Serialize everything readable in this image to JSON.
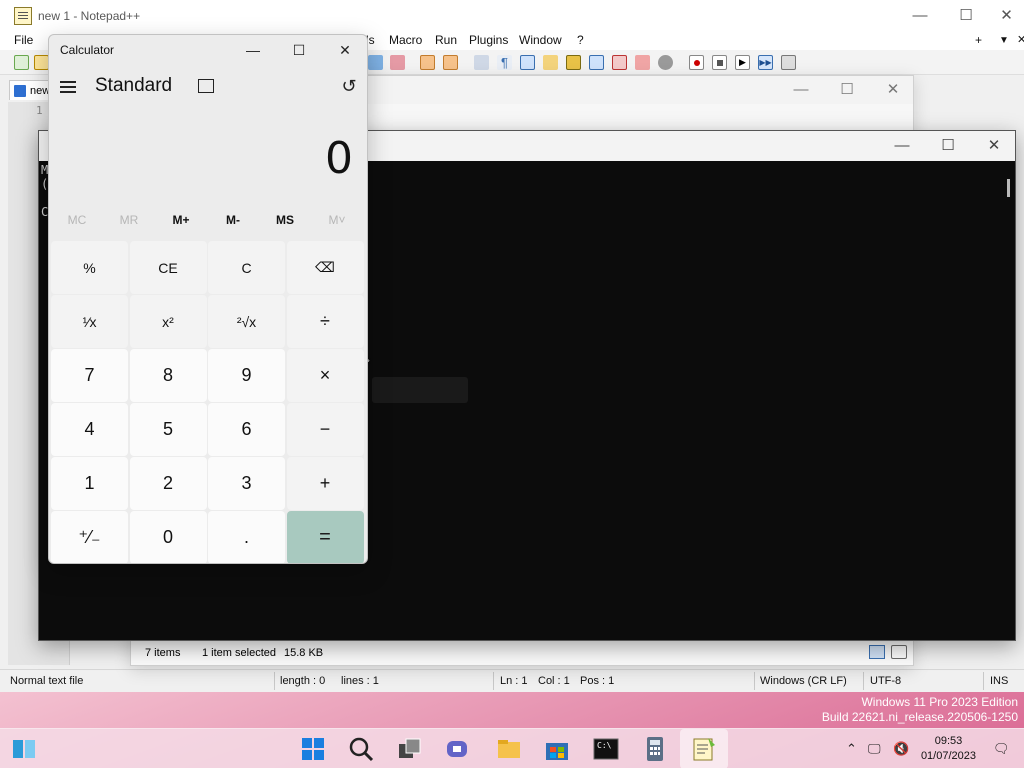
{
  "notepad": {
    "title": "new 1 - Notepad++",
    "menu": [
      "File",
      "Macro",
      "Run",
      "Plugins",
      "Window",
      "?"
    ],
    "menu_fragment": "ls",
    "menu_right": [
      "+",
      "▼",
      "✕"
    ],
    "tab_label": "new",
    "line_number": "1",
    "status": {
      "file_type": "Normal text file",
      "length": "length : 0",
      "lines": "lines : 1",
      "ln": "Ln : 1",
      "col": "Col : 1",
      "pos": "Pos : 1",
      "eol": "Windows (CR LF)",
      "encoding": "UTF-8",
      "mode": "INS"
    }
  },
  "explorer": {
    "status_items": "7 items",
    "status_selected": "1 item selected",
    "status_size": "15.8 KB"
  },
  "terminal": {
    "lines": [
      "M                                    ]",
      "(                                      ved.",
      "",
      "C"
    ]
  },
  "calculator": {
    "title": "Calculator",
    "mode": "Standard",
    "display": "0",
    "memory": [
      "MC",
      "MR",
      "M+",
      "M-",
      "MS",
      "M˅"
    ],
    "memory_enabled": [
      false,
      false,
      true,
      true,
      true,
      false
    ],
    "keys": [
      {
        "label": "%",
        "type": "fn",
        "name": "percent-button"
      },
      {
        "label": "CE",
        "type": "fn",
        "name": "clear-entry-button"
      },
      {
        "label": "C",
        "type": "fn",
        "name": "clear-button"
      },
      {
        "label": "⌫",
        "type": "fn",
        "name": "backspace-button"
      },
      {
        "label": "¹⁄x",
        "type": "fn",
        "name": "reciprocal-button"
      },
      {
        "label": "x²",
        "type": "fn",
        "name": "square-button"
      },
      {
        "label": "²√x",
        "type": "fn",
        "name": "square-root-button"
      },
      {
        "label": "÷",
        "type": "op",
        "name": "divide-button"
      },
      {
        "label": "7",
        "type": "num",
        "name": "digit-7-button"
      },
      {
        "label": "8",
        "type": "num",
        "name": "digit-8-button"
      },
      {
        "label": "9",
        "type": "num",
        "name": "digit-9-button"
      },
      {
        "label": "×",
        "type": "op",
        "name": "multiply-button"
      },
      {
        "label": "4",
        "type": "num",
        "name": "digit-4-button"
      },
      {
        "label": "5",
        "type": "num",
        "name": "digit-5-button"
      },
      {
        "label": "6",
        "type": "num",
        "name": "digit-6-button"
      },
      {
        "label": "−",
        "type": "op",
        "name": "subtract-button"
      },
      {
        "label": "1",
        "type": "num",
        "name": "digit-1-button"
      },
      {
        "label": "2",
        "type": "num",
        "name": "digit-2-button"
      },
      {
        "label": "3",
        "type": "num",
        "name": "digit-3-button"
      },
      {
        "label": "+",
        "type": "op",
        "name": "add-button"
      },
      {
        "label": "⁺⁄₋",
        "type": "num",
        "name": "negate-button"
      },
      {
        "label": "0",
        "type": "num",
        "name": "digit-0-button"
      },
      {
        "label": ".",
        "type": "num",
        "name": "decimal-button"
      },
      {
        "label": "=",
        "type": "eq",
        "name": "equals-button"
      }
    ]
  },
  "desktop": {
    "watermark_line1": "Windows 11 Pro 2023 Edition",
    "watermark_line2": "Build 22621.ni_release.220506-1250"
  },
  "taskbar": {
    "time": "09:53",
    "date": "01/07/2023",
    "icons": [
      "widgets-icon",
      "start-icon",
      "search-icon",
      "task-view-icon",
      "teams-chat-icon",
      "file-explorer-icon",
      "microsoft-store-icon",
      "terminal-icon",
      "calculator-icon",
      "notepad-plus-plus-icon"
    ]
  },
  "colors": {
    "accent_equals": "#a8c9bf",
    "terminal_bg": "#0c0c0c"
  }
}
